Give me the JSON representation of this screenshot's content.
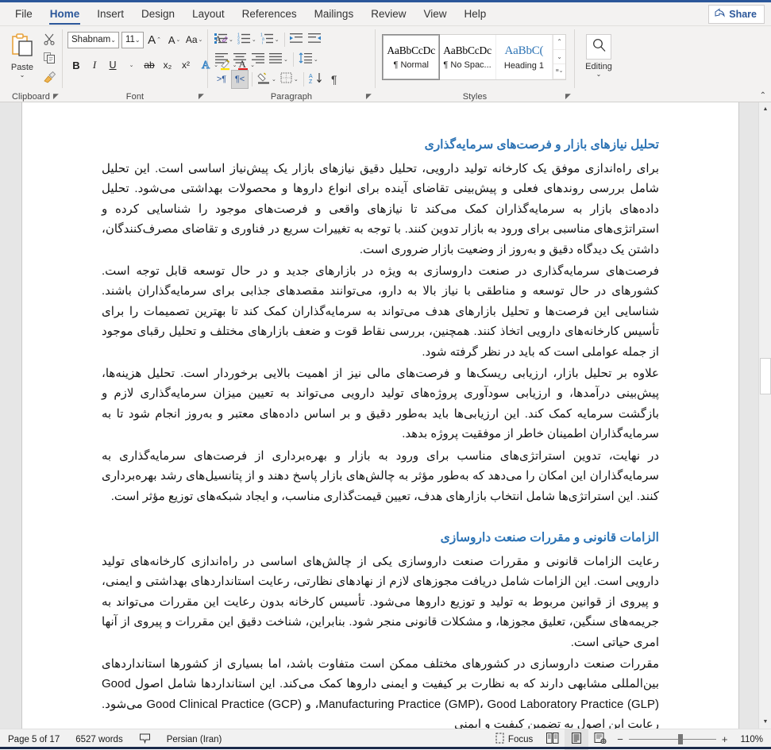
{
  "app": {
    "accent": "#2b579a",
    "heading_color": "#2e74b5"
  },
  "tabs": [
    {
      "label": "File",
      "active": false
    },
    {
      "label": "Home",
      "active": true
    },
    {
      "label": "Insert",
      "active": false
    },
    {
      "label": "Design",
      "active": false
    },
    {
      "label": "Layout",
      "active": false
    },
    {
      "label": "References",
      "active": false
    },
    {
      "label": "Mailings",
      "active": false
    },
    {
      "label": "Review",
      "active": false
    },
    {
      "label": "View",
      "active": false
    },
    {
      "label": "Help",
      "active": false
    }
  ],
  "share": {
    "label": "Share",
    "icon": "share-icon"
  },
  "ribbon": {
    "clipboard": {
      "group_label": "Clipboard",
      "paste_label": "Paste",
      "paste_caret": "⌄",
      "cut_icon": "scissors-icon",
      "copy_icon": "copy-icon",
      "format_painter_icon": "paintbrush-icon",
      "dialog_launcher": "◥"
    },
    "font": {
      "group_label": "Font",
      "font_name": "Shabnam",
      "font_size": "11",
      "grow_font": "A",
      "shrink_font": "A",
      "change_case": "Aa",
      "clear_formatting": "A",
      "bold": "B",
      "italic": "I",
      "underline": "U",
      "strikethrough": "ab",
      "subscript": "x₂",
      "superscript": "x²",
      "text_effects": "A",
      "highlight": "A",
      "font_color": "A",
      "dialog_launcher": "◥"
    },
    "paragraph": {
      "group_label": "Paragraph",
      "bullets": "bullet-list-icon",
      "numbering": "numbered-list-icon",
      "multilevel": "multilevel-list-icon",
      "decrease_indent": "decrease-indent-icon",
      "increase_indent": "increase-indent-icon",
      "align_left": "align-left-icon",
      "align_center": "align-center-icon",
      "align_right": "align-right-icon",
      "justify": "justify-icon",
      "line_spacing": "line-spacing-icon",
      "ltr_text": "ltr-direction-icon",
      "rtl_text": "rtl-direction-icon",
      "rtl_active": true,
      "shading": "shading-icon",
      "borders": "borders-icon",
      "sort": "sort-icon",
      "show_marks": "¶",
      "dialog_launcher": "◥"
    },
    "styles": {
      "group_label": "Styles",
      "gallery": [
        {
          "preview": "AaBbCcDc",
          "name": "¶ Normal",
          "selected": true,
          "heading": false
        },
        {
          "preview": "AaBbCcDc",
          "name": "¶ No Spac...",
          "selected": false,
          "heading": false
        },
        {
          "preview": "AaBbC(",
          "name": "Heading 1",
          "selected": false,
          "heading": true
        }
      ],
      "scroll_up": "⌃",
      "scroll_down": "⌄",
      "more": "⌄",
      "dialog_launcher": "◥"
    },
    "editing": {
      "group_label": "Editing",
      "label": "Editing",
      "icon": "search-icon",
      "caret": "⌄"
    },
    "collapse_ribbon": "⌃"
  },
  "document": {
    "sections": [
      {
        "heading": "تحلیل نیازهای بازار و فرصت‌های سرمایه‌گذاری",
        "paragraphs": [
          "برای راه‌اندازی موفق یک کارخانه تولید دارویی، تحلیل دقیق نیازهای بازار یک پیش‌نیاز اساسی است. این تحلیل شامل بررسی روندهای فعلی و پیش‌بینی تقاضای آینده برای انواع داروها و محصولات بهداشتی می‌شود. تحلیل داده‌های بازار به سرمایه‌گذاران کمک می‌کند تا نیازهای واقعی و فرصت‌های موجود را شناسایی کرده و استراتژی‌های مناسبی برای ورود به بازار تدوین کنند. با توجه به تغییرات سریع در فناوری و تقاضای مصرف‌کنندگان، داشتن یک دیدگاه دقیق و به‌روز از وضعیت بازار ضروری است.",
          "فرصت‌های سرمایه‌گذاری در صنعت داروسازی به ویژه در بازارهای جدید و در حال توسعه قابل توجه است. کشورهای در حال توسعه و مناطقی با نیاز بالا به دارو، می‌توانند مقصدهای جذابی برای سرمایه‌گذاران باشند. شناسایی این فرصت‌ها و تحلیل بازارهای هدف می‌تواند به سرمایه‌گذاران کمک کند تا بهترین تصمیمات را برای تأسیس کارخانه‌های دارویی اتخاذ کنند. همچنین، بررسی نقاط قوت و ضعف بازارهای مختلف و تحلیل رقبای موجود از جمله عواملی است که باید در نظر گرفته شود.",
          "علاوه بر تحلیل بازار، ارزیابی ریسک‌ها و فرصت‌های مالی نیز از اهمیت بالایی برخوردار است. تحلیل هزینه‌ها، پیش‌بینی درآمدها، و ارزیابی سودآوری پروژه‌های تولید دارویی می‌تواند به تعیین میزان سرمایه‌گذاری لازم و بازگشت سرمایه کمک کند. این ارزیابی‌ها باید به‌طور دقیق و بر اساس داده‌های معتبر و به‌روز انجام شود تا به سرمایه‌گذاران اطمینان خاطر از موفقیت پروژه بدهد.",
          "در نهایت، تدوین استراتژی‌های مناسب برای ورود به بازار و بهره‌برداری از فرصت‌های سرمایه‌گذاری به سرمایه‌گذاران این امکان را می‌دهد که به‌طور مؤثر به چالش‌های بازار پاسخ دهند و از پتانسیل‌های رشد بهره‌برداری کنند. این استراتژی‌ها شامل انتخاب بازارهای هدف، تعیین قیمت‌گذاری مناسب، و ایجاد شبکه‌های توزیع مؤثر است."
        ]
      },
      {
        "heading": "الزامات قانونی و مقررات صنعت داروسازی",
        "paragraphs": [
          "رعایت الزامات قانونی و مقررات صنعت داروسازی یکی از چالش‌های اساسی در راه‌اندازی کارخانه‌های تولید دارویی است. این الزامات شامل دریافت مجوزهای لازم از نهادهای نظارتی، رعایت استانداردهای بهداشتی و ایمنی، و پیروی از قوانین مربوط به تولید و توزیع داروها می‌شود. تأسیس کارخانه بدون رعایت این مقررات می‌تواند به جریمه‌های سنگین، تعلیق مجوزها، و مشکلات قانونی منجر شود. بنابراین، شناخت دقیق این مقررات و پیروی از آنها امری حیاتی است.",
          "مقررات صنعت داروسازی در کشورهای مختلف ممکن است متفاوت باشد، اما بسیاری از کشورها استانداردهای بین‌المللی مشابهی دارند که به نظارت بر کیفیت و ایمنی داروها کمک می‌کند. این استانداردها شامل اصول Good Manufacturing Practice (GMP)، Good Laboratory Practice (GLP)، و Good Clinical Practice (GCP) می‌شود. رعایت این اصول به تضمین کیفیت و ایمنی"
        ]
      }
    ]
  },
  "status": {
    "page": "Page 5 of 17",
    "words": "6527 words",
    "proofing_icon": "proofing-check-icon",
    "language": "Persian (Iran)",
    "focus": "Focus",
    "focus_icon": "focus-icon",
    "view_read": "read-mode-icon",
    "view_print": "print-layout-icon",
    "view_web": "web-layout-icon",
    "active_view": "print-layout-icon",
    "zoom_out": "−",
    "zoom_in": "+",
    "zoom_level": "110%"
  }
}
